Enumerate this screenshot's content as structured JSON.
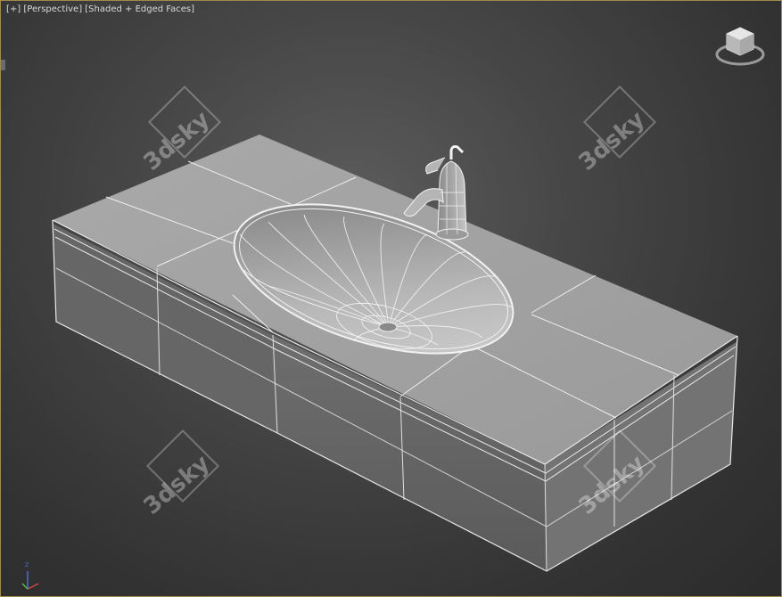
{
  "viewport": {
    "label_plus": "[+]",
    "label_view": "[Perspective]",
    "label_shading": "[Shaded + Edged Faces]",
    "background_color": "#3f3f3f",
    "border_color": "#a28a4a"
  },
  "watermarks": [
    "3dsky",
    "3dsky",
    "3dsky",
    "3dsky"
  ],
  "viewcube": {
    "icon": "viewcube-icon"
  },
  "axis_tripod": {
    "z_label": "z",
    "icon": "axis-tripod-icon"
  },
  "model": {
    "icon": "sink-vanity-model"
  }
}
